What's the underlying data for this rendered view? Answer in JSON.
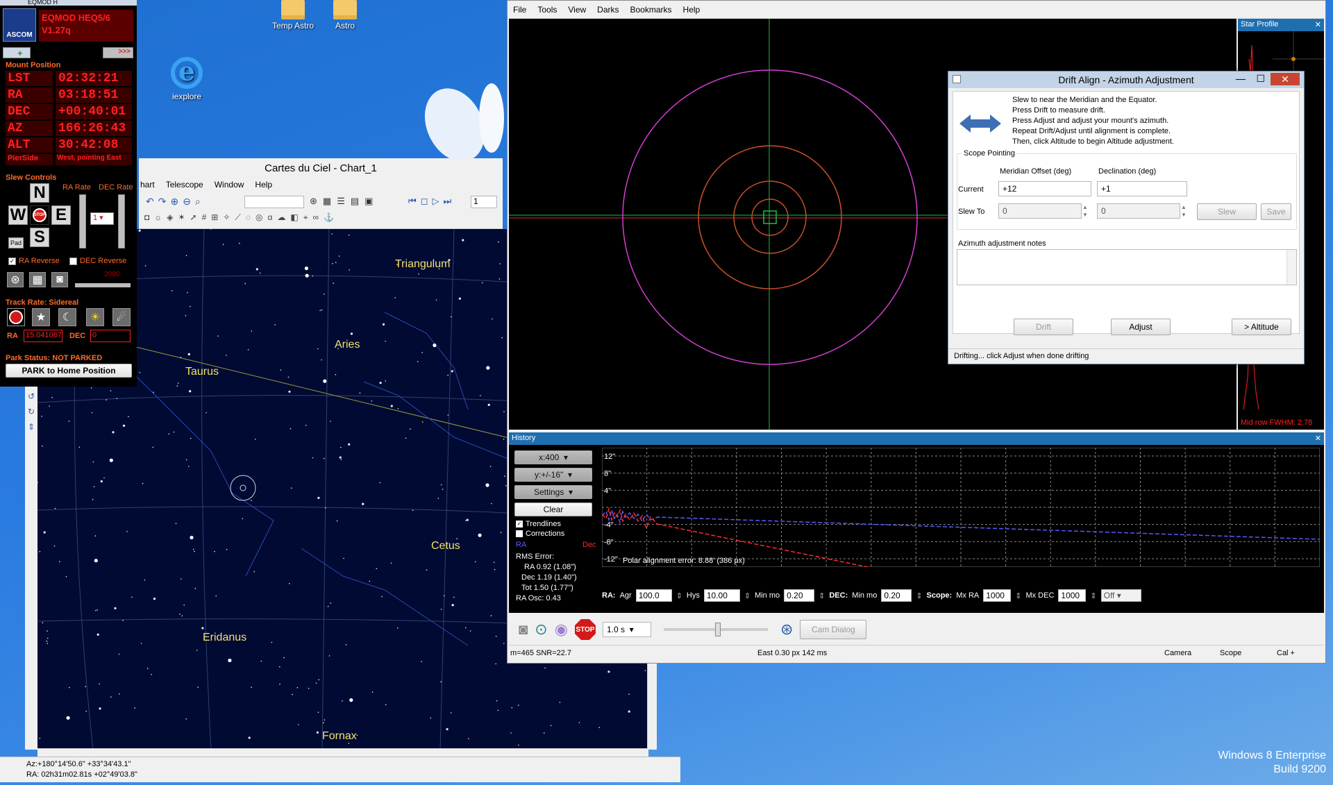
{
  "desktop": {
    "icons": [
      {
        "label": "Temp Astro"
      },
      {
        "label": "Astro"
      },
      {
        "label": "iexplore"
      }
    ],
    "windows_edition": "Windows 8 Enterprise",
    "build": "Build 9200"
  },
  "eqmod": {
    "title": "EQMOD H",
    "ascom_label": "ASCOM",
    "model": "EQMOD HEQ5/6",
    "version": "V1.27q",
    "mount_position_title": "Mount Position",
    "rows": [
      {
        "label": "LST",
        "value": "02:32:21"
      },
      {
        "label": "RA",
        "value": "03:18:51"
      },
      {
        "label": "DEC",
        "value": "+00:40:01"
      },
      {
        "label": "AZ",
        "value": "166:26:43"
      },
      {
        "label": "ALT",
        "value": "30:42:08"
      }
    ],
    "pierside_label": "PierSide",
    "pierside_value": "West, pointing East",
    "slew_controls_title": "Slew Controls",
    "ra_rate_label": "RA Rate",
    "dec_rate_label": "DEC Rate",
    "dir_n": "N",
    "dir_w": "W",
    "dir_e": "E",
    "dir_s": "S",
    "stop_label": "STOP",
    "pad_label": "Pad",
    "rate_value": "1",
    "ra_reverse": "RA Reverse",
    "dec_reverse": "DEC Reverse",
    "slider_value": "2000",
    "track_rate_title": "Track Rate: Sidereal",
    "track_ra_label": "RA",
    "track_ra_value": "15.041067",
    "track_dec_label": "DEC",
    "track_dec_value": "0",
    "park_status": "Park Status: NOT PARKED",
    "park_button": "PARK to Home Position"
  },
  "cartes": {
    "title": "Cartes du Ciel - Chart_1",
    "menu": [
      "hart",
      "Telescope",
      "Window",
      "Help"
    ],
    "chart_number": "1",
    "constellations": [
      "Triangulum",
      "Aries",
      "Taurus",
      "Cetus",
      "Eridanus",
      "Fornax"
    ],
    "status_line1": "Az:+180°14'50.6\" +33°34'43.1\"",
    "status_line2": "RA: 02h31m02.81s +02°49'03.8\""
  },
  "phd": {
    "menu": [
      "File",
      "Tools",
      "View",
      "Darks",
      "Bookmarks",
      "Help"
    ],
    "star_profile_title": "Star Profile",
    "star_profile_fwhm": "Mid row FWHM: 2.78",
    "history_title": "History",
    "x_scale": "x:400",
    "y_scale": "y:+/-16\"",
    "settings_label": "Settings",
    "clear_label": "Clear",
    "trendlines_label": "Trendlines",
    "corrections_label": "Corrections",
    "ra_legend": "RA",
    "dec_legend": "Dec",
    "rms_title": "RMS Error:",
    "rms_ra": "RA 0.92 (1.08\")",
    "rms_dec": "Dec 1.19 (1.40\")",
    "rms_tot": "Tot 1.50 (1.77\")",
    "ra_osc": "RA Osc: 0.43",
    "y_ticks": [
      "12\"",
      "8\"",
      "4\"",
      "",
      "-4\"",
      "-8\"",
      "-12\""
    ],
    "polar_error": "Polar alignment error: 8.88' (386 px)",
    "params": {
      "ra_label": "RA:",
      "agr_label": "Agr",
      "agr_value": "100.0",
      "hys_label": "Hys",
      "hys_value": "10.00",
      "minmo_label": "Min mo",
      "minmo_value": "0.20",
      "dec_label": "DEC:",
      "dec_minmo_label": "Min mo",
      "dec_minmo_value": "0.20",
      "scope_label": "Scope:",
      "mxra_label": "Mx RA",
      "mxra_value": "1000",
      "mxdec_label": "Mx DEC",
      "mxdec_value": "1000",
      "mode_value": "Off"
    },
    "exposure": "1.0 s",
    "stop_label": "STOP",
    "cam_dialog": "Cam Dialog",
    "status_left": "m=465 SNR=22.7",
    "status_mid": "East  0.30 px 142 ms",
    "status_camera": "Camera",
    "status_scope": "Scope",
    "status_cal": "Cal +"
  },
  "drift": {
    "title": "Drift Align - Azimuth Adjustment",
    "instructions": [
      "Slew to near the Meridian and the Equator.",
      "Press Drift to measure drift.",
      "Press Adjust and adjust your mount's azimuth.",
      "Repeat Drift/Adjust until alignment is complete.",
      "Then, click Altitude to begin Altitude adjustment."
    ],
    "scope_pointing": "Scope Pointing",
    "col_meridian": "Meridian Offset (deg)",
    "col_declination": "Declination (deg)",
    "current_label": "Current",
    "current_meridian": "+12",
    "current_dec": "+1",
    "slewto_label": "Slew To",
    "slewto_meridian": "0",
    "slewto_dec": "0",
    "slew_btn": "Slew",
    "save_btn": "Save",
    "notes_label": "Azimuth adjustment notes",
    "drift_btn": "Drift",
    "adjust_btn": "Adjust",
    "altitude_btn": "> Altitude",
    "status": "Drifting... click Adjust when done drifting"
  },
  "colors": {
    "led_red": "#ff2020",
    "magenta_ring": "#d43fd4",
    "ra_line": "#5a5aff",
    "dec_line": "#ff2a2a"
  }
}
